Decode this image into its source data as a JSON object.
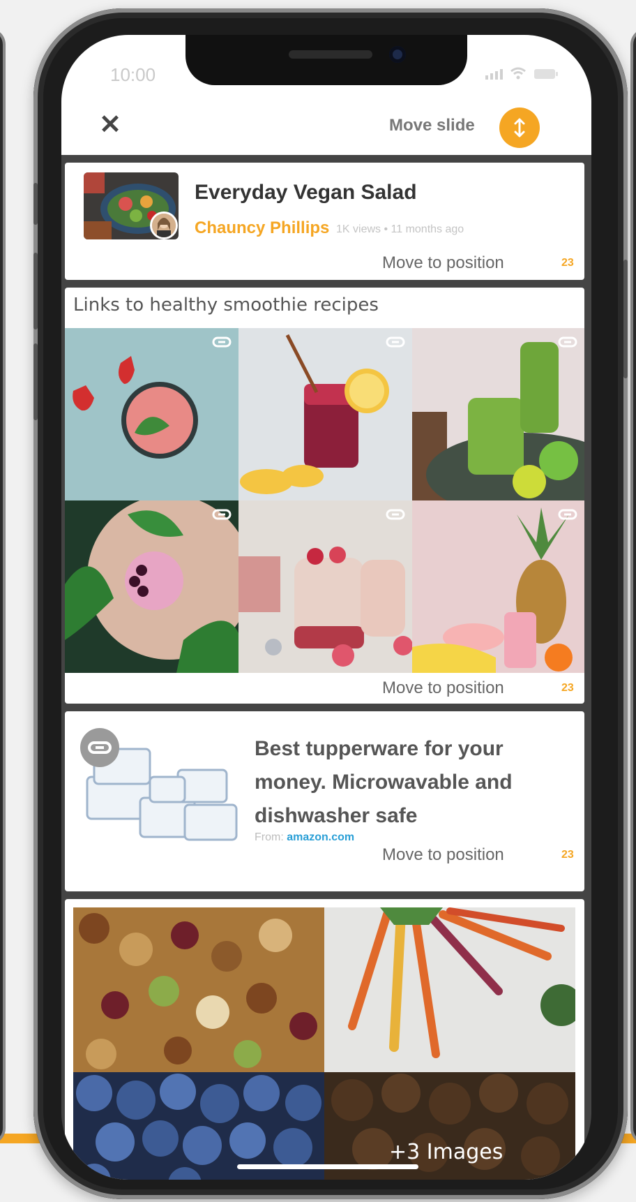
{
  "status_bar": {
    "time": "10:00"
  },
  "header": {
    "close_label": "✕",
    "move_slide_label": "Move slide"
  },
  "video_card": {
    "title": "Everyday Vegan Salad",
    "channel": "Chauncy Phillips",
    "meta": "1K views • 11 months ago",
    "move_label": "Move to position",
    "position": "23"
  },
  "gallery_card": {
    "title": "Links to healthy smoothie recipes",
    "move_label": "Move to position",
    "position": "23"
  },
  "link_card": {
    "headline": "Best tupperware for your money. Microwavable and dishwasher safe",
    "source_prefix": "From: ",
    "domain": "amazon.com",
    "move_label": "Move to position",
    "position": "23"
  },
  "collage_card": {
    "more_label": "+3 Images"
  },
  "colors": {
    "accent": "#f5a623",
    "link": "#2a9fd6"
  }
}
